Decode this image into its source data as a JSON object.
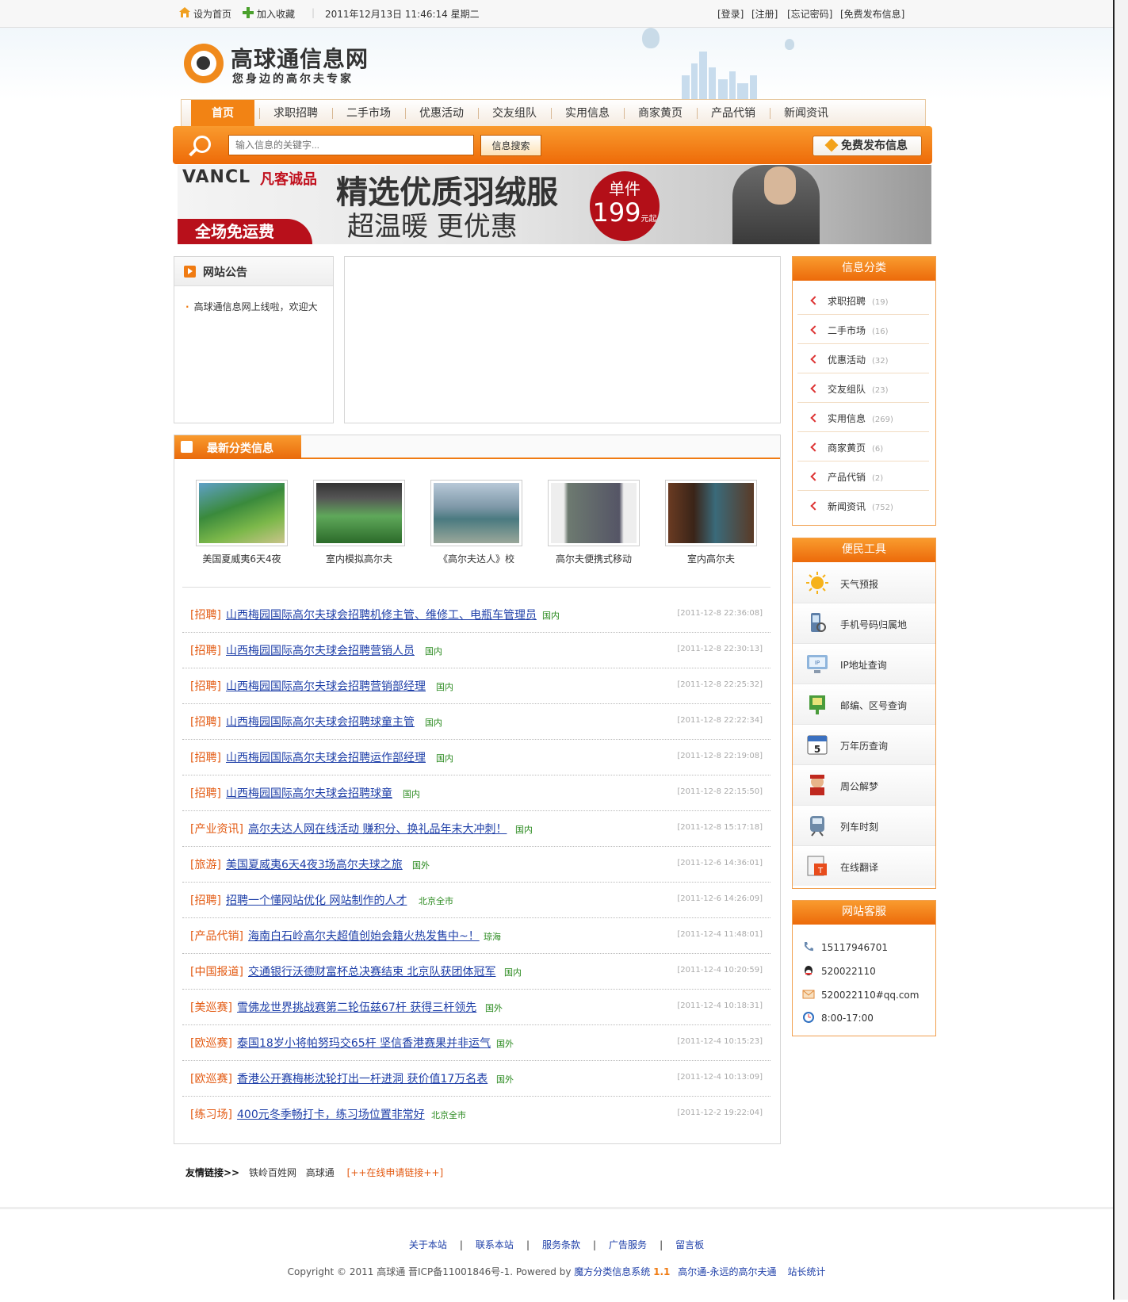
{
  "topbar": {
    "set_home": "设为首页",
    "add_fav": "加入收藏",
    "datetime": "2011年12月13日  11:46:14 星期二",
    "login": "[登录]",
    "register": "[注册]",
    "forgot": "[忘记密码]",
    "post_free": "[免费发布信息]"
  },
  "logo": {
    "title": "高球通信息网",
    "slogan": "您身边的高尔夫专家"
  },
  "nav": {
    "tabs": [
      "首页",
      "求职招聘",
      "二手市场",
      "优惠活动",
      "交友组队",
      "实用信息",
      "商家黄页",
      "产品代销",
      "新闻资讯"
    ]
  },
  "search": {
    "placeholder": "输入信息的关键字...",
    "button": "信息搜索",
    "post_button": "免费发布信息"
  },
  "banner": {
    "brand": "VANCL",
    "brand_cn": "凡客诚品",
    "free_shipping": "全场免运费",
    "headline": "精选优质羽绒服",
    "subline": "超温暖 更优惠",
    "badge_top": "单件",
    "badge_price": "199",
    "badge_unit": "元起"
  },
  "notice": {
    "title": "网站公告",
    "items": [
      "高球通信息网上线啦，欢迎大"
    ]
  },
  "latest": {
    "title": "最新分类信息",
    "thumbs": [
      "美国夏威夷6天4夜",
      "室内模拟高尔夫",
      "《高尔夫达人》校",
      "高尔夫便携式移动",
      "室内高尔夫"
    ],
    "rows": [
      {
        "cat": "[招聘]",
        "title": "山西梅园国际高尔夫球会招聘机修主管、维修工、电瓶车管理员",
        "area": "国内",
        "date": "[2011-12-8 22:36:08]"
      },
      {
        "cat": "[招聘]",
        "title": "山西梅园国际高尔夫球会招聘营销人员",
        "area": "国内",
        "date": "[2011-12-8 22:30:13]"
      },
      {
        "cat": "[招聘]",
        "title": "山西梅园国际高尔夫球会招聘营销部经理",
        "area": "国内",
        "date": "[2011-12-8 22:25:32]"
      },
      {
        "cat": "[招聘]",
        "title": "山西梅园国际高尔夫球会招聘球童主管",
        "area": "国内",
        "date": "[2011-12-8 22:22:34]"
      },
      {
        "cat": "[招聘]",
        "title": "山西梅园国际高尔夫球会招聘运作部经理",
        "area": "国内",
        "date": "[2011-12-8 22:19:08]"
      },
      {
        "cat": "[招聘]",
        "title": "山西梅园国际高尔夫球会招聘球童",
        "area": "国内",
        "date": "[2011-12-8 22:15:50]"
      },
      {
        "cat": "[产业资讯]",
        "title": "高尔夫达人网在线活动 赚积分、换礼品年末大冲刺！",
        "area": "国内",
        "date": "[2011-12-8 15:17:18]"
      },
      {
        "cat": "[旅游]",
        "title": "美国夏威夷6天4夜3场高尔夫球之旅",
        "area": "国外",
        "date": "[2011-12-6 14:36:01]"
      },
      {
        "cat": "[招聘]",
        "title": "招聘一个懂网站优化 网站制作的人才",
        "area": "北京全市",
        "date": "[2011-12-6 14:26:09]"
      },
      {
        "cat": "[产品代销]",
        "title": "海南白石岭高尔夫超值创始会籍火热发售中~！",
        "area": "琼海",
        "date": "[2011-12-4 11:48:01]"
      },
      {
        "cat": "[中国报道]",
        "title": "交通银行沃德财富杯总决赛结束 北京队获团体冠军",
        "area": "国内",
        "date": "[2011-12-4 10:20:59]"
      },
      {
        "cat": "[美巡赛]",
        "title": "雪佛龙世界挑战赛第二轮伍兹67杆 获得三杆领先",
        "area": "国外",
        "date": "[2011-12-4 10:18:31]"
      },
      {
        "cat": "[欧巡赛]",
        "title": "泰国18岁小将帕努玛交65杆 坚信香港赛果并非运气",
        "area": "国外",
        "date": "[2011-12-4 10:15:23]"
      },
      {
        "cat": "[欧巡赛]",
        "title": "香港公开赛梅彬沈轮打出一杆进洞 获价值17万名表",
        "area": "国外",
        "date": "[2011-12-4 10:13:09]"
      },
      {
        "cat": "[练习场]",
        "title": "400元冬季畅打卡，练习场位置非常好",
        "area": "北京全市",
        "date": "[2011-12-2 19:22:04]"
      }
    ]
  },
  "categories": {
    "title": "信息分类",
    "items": [
      {
        "label": "求职招聘",
        "count": "(19)"
      },
      {
        "label": "二手市场",
        "count": "(16)"
      },
      {
        "label": "优惠活动",
        "count": "(32)"
      },
      {
        "label": "交友组队",
        "count": "(23)"
      },
      {
        "label": "实用信息",
        "count": "(269)"
      },
      {
        "label": "商家黄页",
        "count": "(6)"
      },
      {
        "label": "产品代销",
        "count": "(2)"
      },
      {
        "label": "新闻资讯",
        "count": "(752)"
      }
    ]
  },
  "tools": {
    "title": "便民工具",
    "items": [
      "天气预报",
      "手机号码归属地",
      "IP地址查询",
      "邮编、区号查询",
      "万年历查询",
      "周公解梦",
      "列车时刻",
      "在线翻译"
    ]
  },
  "service": {
    "title": "网站客服",
    "phone": "15117946701",
    "qq": "520022110",
    "email": "520022110#qq.com",
    "hours": "8:00-17:00"
  },
  "friend_links": {
    "label": "友情链接>>",
    "items": [
      "铁岭百姓网",
      "高球通"
    ],
    "apply": "[++在线申请链接++]"
  },
  "footer": {
    "links": [
      "关于本站",
      "联系本站",
      "服务条款",
      "广告服务",
      "留言板"
    ],
    "copyright": "Copyright © 2011 高球通  晋ICP备11001846号-1.  Powered by",
    "powered": "魔方分类信息系统",
    "version": "1.1",
    "tagline": "高尔通-永远的高尔夫通",
    "stats": "站长统计"
  },
  "colors": {
    "accent": "#f07b12",
    "link": "#1e3fa8",
    "category": "#e35a12",
    "area": "#2a8a1e"
  }
}
